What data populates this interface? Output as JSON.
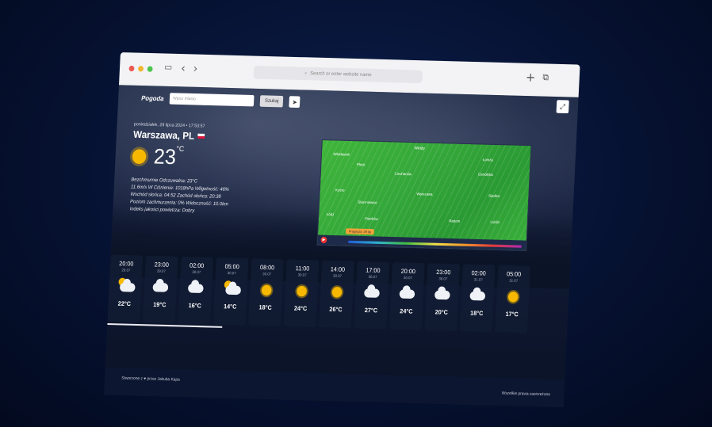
{
  "browser": {
    "url_placeholder": "Search or enter website name"
  },
  "app": {
    "brand": "Pogoda",
    "search_placeholder": "Wpisz miasto",
    "search_button": "Szukaj"
  },
  "current": {
    "datetime": "poniedziałek, 29 lipca 2024 • 17:53:57",
    "city": "Warszawa, PL",
    "temperature": "23",
    "unit": "°C",
    "details": {
      "line1": "Bezchmurnie  Odczuwalna: 23°C",
      "line2": "11.6m/s W  Ciśnienie: 1018hPa  Wilgotność: 46%",
      "line3": "Wschód słońca: 04:52  Zachód słońca: 20:38",
      "line4": "Poziom zachmurzenia: 0%  Widoczność: 10.0km",
      "line5": "Indeks jakości powietrza: Dobry"
    }
  },
  "map": {
    "logo": "Windy",
    "labels": [
      "Płock",
      "Włocławek",
      "Ciechanów",
      "Ostrołęka",
      "Łomża",
      "Warszawa",
      "Kutno",
      "Łódź",
      "Piotrków",
      "Radom",
      "Siedlce",
      "Lublin",
      "Skierniewice"
    ],
    "chip": "Prognoza: 29 lip",
    "more": "More"
  },
  "forecast": [
    {
      "time": "20:00",
      "date": "29.07",
      "icon": "partly-sunny-icon",
      "temp": "22°C"
    },
    {
      "time": "23:00",
      "date": "29.07",
      "icon": "cloud-icon",
      "temp": "19°C"
    },
    {
      "time": "02:00",
      "date": "30.07",
      "icon": "cloud-icon",
      "temp": "16°C"
    },
    {
      "time": "05:00",
      "date": "30.07",
      "icon": "partly-sunny-icon",
      "temp": "14°C"
    },
    {
      "time": "08:00",
      "date": "30.07",
      "icon": "sun-icon",
      "temp": "18°C"
    },
    {
      "time": "11:00",
      "date": "30.07",
      "icon": "sun-icon",
      "temp": "24°C"
    },
    {
      "time": "14:00",
      "date": "30.07",
      "icon": "sun-icon",
      "temp": "26°C"
    },
    {
      "time": "17:00",
      "date": "30.07",
      "icon": "cloud-icon",
      "temp": "27°C"
    },
    {
      "time": "20:00",
      "date": "30.07",
      "icon": "cloud-icon",
      "temp": "24°C"
    },
    {
      "time": "23:00",
      "date": "30.07",
      "icon": "cloud-icon",
      "temp": "20°C"
    },
    {
      "time": "02:00",
      "date": "31.07",
      "icon": "cloud-icon",
      "temp": "18°C"
    },
    {
      "time": "05:00",
      "date": "31.07",
      "icon": "sun-icon",
      "temp": "17°C"
    }
  ],
  "footer": {
    "credit": "Stworzone z ♥ przez Jakuba Kapa",
    "rights": "Wszelkie prawa zastrzeżone"
  }
}
